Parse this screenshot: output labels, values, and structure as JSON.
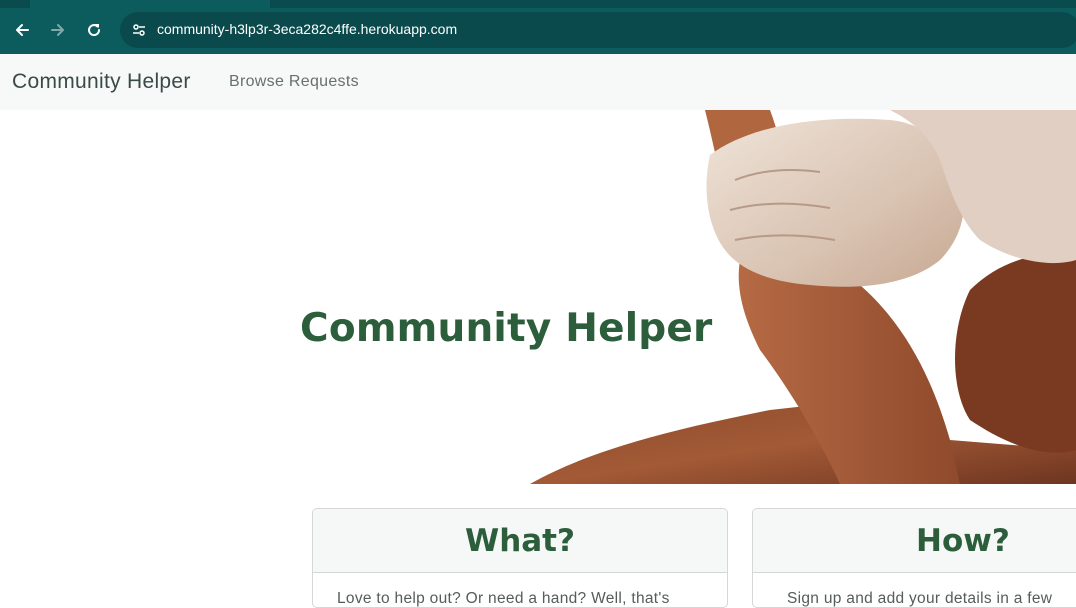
{
  "browser": {
    "url": "community-h3lp3r-3eca282c4ffe.herokuapp.com",
    "back_icon": "arrow-left-icon",
    "forward_icon": "arrow-right-icon",
    "reload_icon": "reload-icon",
    "site_info_icon": "tune-icon",
    "chrome_color": "#0c5c5e"
  },
  "navbar": {
    "brand": "Community Helper",
    "links": [
      "Browse Requests"
    ]
  },
  "hero": {
    "title": "Community Helper",
    "image": "interlocked-hands-image"
  },
  "cards": [
    {
      "title": "What?",
      "body": "Love to help out? Or need a hand? Well, that's"
    },
    {
      "title": "How?",
      "body": "Sign up and add your details in a few"
    }
  ],
  "colors": {
    "accent_green": "#2c5e3c",
    "navbar_bg": "#f7f9f8"
  }
}
